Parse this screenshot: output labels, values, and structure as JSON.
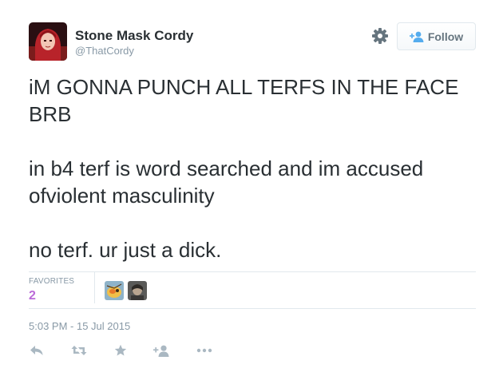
{
  "user": {
    "display_name": "Stone Mask Cordy",
    "handle": "@ThatCordy"
  },
  "follow_button": {
    "label": "Follow"
  },
  "tweet": {
    "text": "iM GONNA PUNCH ALL TERFS IN THE FACE BRB\n\nin b4 terf is word searched and im accused ofviolent masculinity\n\nno terf. ur just a dick."
  },
  "stats": {
    "favorites_label": "FAVORITES",
    "favorites_count": "2"
  },
  "timestamp": "5:03 PM - 15 Jul 2015",
  "icons": {
    "settings": "gear-icon",
    "follow": "add-user-icon",
    "reply": "reply-icon",
    "retweet": "retweet-icon",
    "favorite": "star-icon",
    "follow_action": "add-user-icon",
    "more": "more-icon"
  },
  "colors": {
    "favorites_count": "#bb6bd9",
    "muted": "#8899a6",
    "icon": "#aab8c2",
    "divider": "#e1e8ed"
  }
}
